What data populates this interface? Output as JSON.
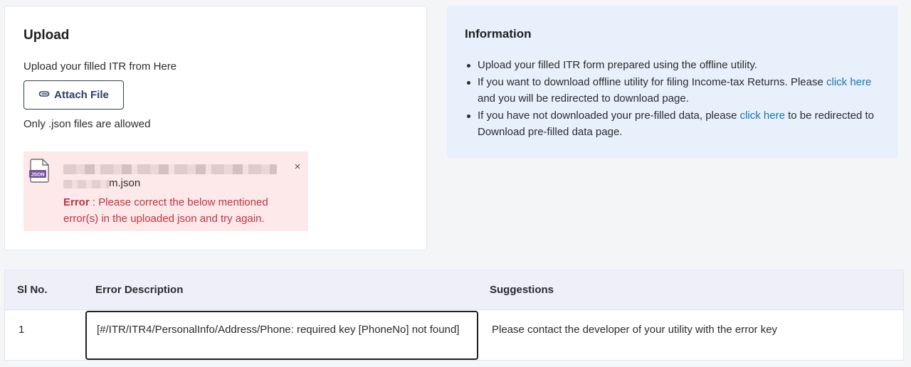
{
  "upload": {
    "title": "Upload",
    "subtitle": "Upload your filled ITR from Here",
    "attach_label": "Attach File",
    "allowed_note": "Only .json files are allowed",
    "file": {
      "name_visible": "m.json",
      "close_glyph": "×",
      "icon": "json-file-icon"
    },
    "error": {
      "label": "Error",
      "separator": " : ",
      "message": "Please correct the below mentioned error(s) in the uploaded json and try again."
    }
  },
  "information": {
    "title": "Information",
    "items": [
      {
        "text": "Upload your filled ITR form prepared using the offline utility."
      },
      {
        "before": "If you want to download offline utility for filing Income-tax Returns. Please ",
        "link": "click here",
        "after": " and you will be redirected to download page."
      },
      {
        "before": "If you have not downloaded your pre-filled data, please ",
        "link": "click here",
        "after": " to be redirected to Download pre-filled data page."
      }
    ]
  },
  "errors_table": {
    "headers": [
      "Sl No.",
      "Error Description",
      "Suggestions"
    ],
    "rows": [
      {
        "sl": "1",
        "description": "[#/ITR/ITR4/PersonalInfo/Address/Phone: required key [PhoneNo] not found]",
        "suggestion": "Please contact the developer of your utility with the error key"
      }
    ]
  },
  "colors": {
    "error_text": "#c1323f",
    "error_bg": "#fde8ea",
    "info_bg": "#e8f0fb",
    "link": "#1a73b5",
    "button_border": "#2c3e63"
  }
}
